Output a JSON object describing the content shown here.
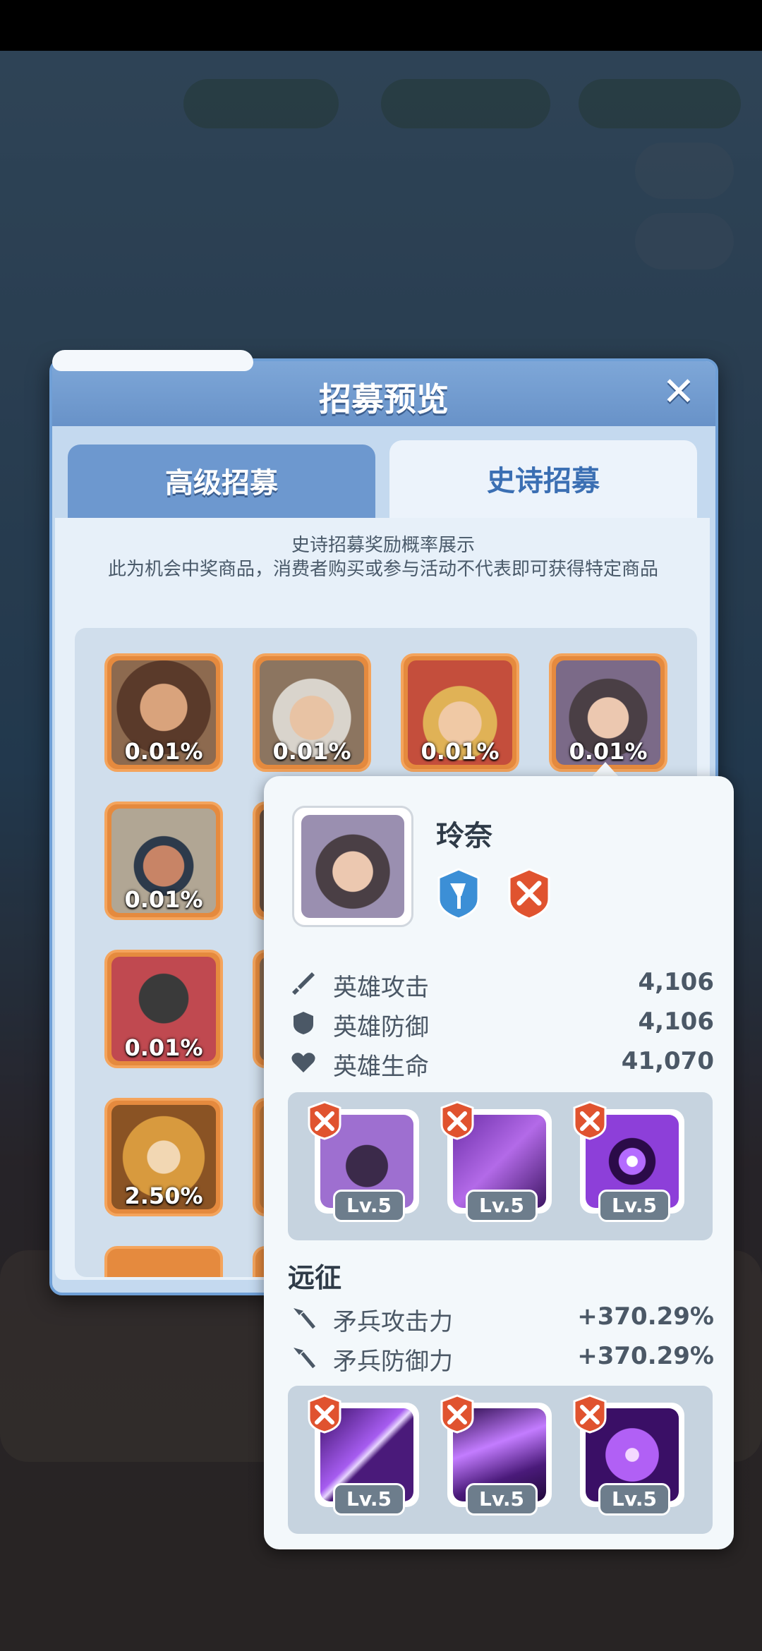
{
  "dialog": {
    "title": "招募预览",
    "close_symbol": "✕",
    "tabs": [
      {
        "label": "高级招募",
        "selected": false
      },
      {
        "label": "史诗招募",
        "selected": true
      }
    ],
    "info_title": "史诗招募奖励概率展示",
    "info_text": "此为机会中奖商品，消费者购买或参与活动不代表即可获得特定商品"
  },
  "reward_cards": [
    {
      "pct": "0.01%"
    },
    {
      "pct": "0.01%"
    },
    {
      "pct": "0.01%"
    },
    {
      "pct": "0.01%"
    },
    {
      "pct": "0.01%"
    },
    {
      "pct": "0.01%"
    },
    {
      "pct": "2.50%"
    }
  ],
  "hero_tooltip": {
    "name": "玲奈",
    "stats": [
      {
        "icon": "sword-icon",
        "label": "英雄攻击",
        "value": "4,106"
      },
      {
        "icon": "shield-icon",
        "label": "英雄防御",
        "value": "4,106"
      },
      {
        "icon": "heart-icon",
        "label": "英雄生命",
        "value": "41,070"
      }
    ],
    "hero_skills": [
      {
        "level": "Lv.5"
      },
      {
        "level": "Lv.5"
      },
      {
        "level": "Lv.5"
      }
    ],
    "expedition_title": "远征",
    "expedition_stats": [
      {
        "icon": "spear-icon",
        "label": "矛兵攻击力",
        "value": "+370.29%"
      },
      {
        "icon": "spear-icon",
        "label": "矛兵防御力",
        "value": "+370.29%"
      }
    ],
    "expedition_skills": [
      {
        "level": "Lv.5"
      },
      {
        "level": "Lv.5"
      },
      {
        "level": "Lv.5"
      }
    ]
  },
  "colors": {
    "card_orange": "#e58a3e",
    "tab_active_text": "#3b6fb3",
    "header_blue": "#6892c8"
  }
}
